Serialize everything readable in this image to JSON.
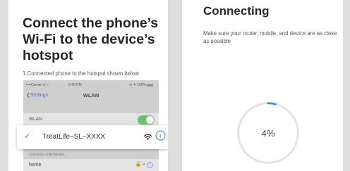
{
  "left_page": {
    "title": "Connect the phone’s Wi-Fi to the device’s hotspot",
    "instruction": "1.Connected phone to the hotspot shown below",
    "phone": {
      "carrier": "••••Carrier ⊙ ≈",
      "time": "2:49 PM",
      "battery_text": "⊙ ✦ 100%",
      "back_label": "Settings",
      "nav_title": "WLAN",
      "wlan_label": "WLAN",
      "wlan_enabled": true,
      "section_header": "CHOOSE A NETWORK...",
      "other_network": "home"
    },
    "selected_network": {
      "ssid": "TreatLife–SL–XXXX",
      "check": "✓",
      "info": "i"
    }
  },
  "right_page": {
    "title": "Connecting",
    "subtitle": "Make sure your router, mobile, and device are as close as possible",
    "progress_percent": 4,
    "progress_label": "4%"
  },
  "colors": {
    "accent_blue": "#3478f6",
    "toggle_green": "#6cc06c",
    "ring_track": "#e2e2e2",
    "ring_progress": "#4a90e2"
  },
  "icons": [
    "back-chevron-icon",
    "wifi-icon",
    "info-icon",
    "lock-icon",
    "check-icon"
  ]
}
